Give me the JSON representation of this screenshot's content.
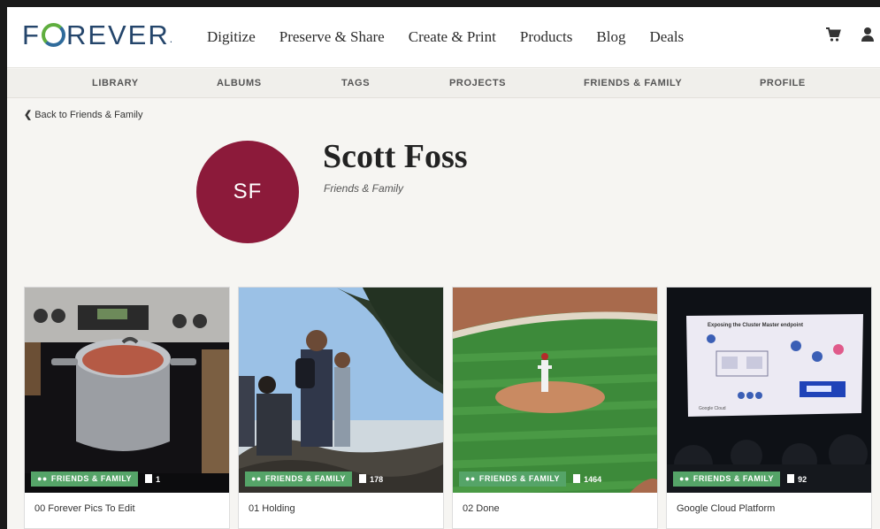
{
  "header": {
    "logo_text_pre": "F",
    "logo_text_post": "REVER",
    "logo_reg": ".",
    "nav": [
      "Digitize",
      "Preserve & Share",
      "Create & Print",
      "Products",
      "Blog",
      "Deals"
    ],
    "icons": [
      "cart-icon",
      "user-icon"
    ]
  },
  "subnav": [
    "LIBRARY",
    "ALBUMS",
    "TAGS",
    "PROJECTS",
    "FRIENDS & FAMILY",
    "PROFILE"
  ],
  "back_link": "Back to Friends & Family",
  "profile": {
    "initials": "SF",
    "name": "Scott Foss",
    "relation": "Friends & Family",
    "avatar_color": "#8c1a3a"
  },
  "albums": [
    {
      "title": "00 Forever Pics To Edit",
      "badge": "FRIENDS & FAMILY",
      "count": "1"
    },
    {
      "title": "01 Holding",
      "badge": "FRIENDS & FAMILY",
      "count": "178"
    },
    {
      "title": "02 Done",
      "badge": "FRIENDS & FAMILY",
      "count": "1464"
    },
    {
      "title": "Google Cloud Platform",
      "badge": "FRIENDS & FAMILY",
      "count": "92"
    }
  ],
  "slide_text": {
    "heading": "Exposing the Cluster Master endpoint",
    "brand": "Google Cloud"
  },
  "colors": {
    "brand_navy": "#24456b",
    "brand_green": "#5fae3e",
    "badge_green": "#55a468"
  }
}
